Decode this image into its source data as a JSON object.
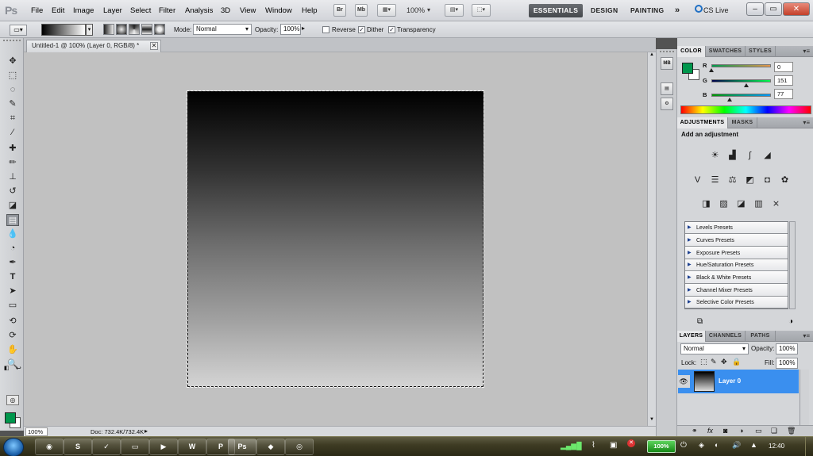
{
  "app": {
    "logo": "Ps"
  },
  "menu": [
    "File",
    "Edit",
    "Image",
    "Layer",
    "Select",
    "Filter",
    "Analysis",
    "3D",
    "View",
    "Window",
    "Help"
  ],
  "appbar": {
    "bridge": "Br",
    "minibridge": "Mb",
    "zoom": "100%",
    "more": "»"
  },
  "workspaces": [
    "ESSENTIALS",
    "DESIGN",
    "PAINTING"
  ],
  "cs_live": "CS Live",
  "window_controls": {
    "minimize": "–",
    "restore": "▭",
    "close": "✕"
  },
  "options": {
    "mode_label": "Mode:",
    "mode_value": "Normal",
    "opacity_label": "Opacity:",
    "opacity_value": "100%",
    "reverse_label": "Reverse",
    "dither_label": "Dither",
    "transparency_label": "Transparency",
    "reverse_checked": false,
    "dither_checked": true,
    "transparency_checked": true
  },
  "document_tab": {
    "title": "Untitled-1 @ 100% (Layer 0, RGB/8) *",
    "close": "✕"
  },
  "status": {
    "zoom": "100%",
    "doc": "Doc: 732.4K/732.4K"
  },
  "colors": {
    "foreground": "#00974d",
    "background": "#ffffff",
    "selected_layer": "#3a8fef"
  },
  "color_panel": {
    "tabs": [
      "COLOR",
      "SWATCHES",
      "STYLES"
    ],
    "channels": [
      {
        "label": "R",
        "value": "0",
        "level": 0.0
      },
      {
        "label": "G",
        "value": "151",
        "level": 0.59
      },
      {
        "label": "B",
        "value": "77",
        "level": 0.3
      }
    ]
  },
  "adjustments_panel": {
    "tabs": [
      "ADJUSTMENTS",
      "MASKS"
    ],
    "heading": "Add an adjustment",
    "presets": [
      "Levels Presets",
      "Curves Presets",
      "Exposure Presets",
      "Hue/Saturation Presets",
      "Black & White Presets",
      "Channel Mixer Presets",
      "Selective Color Presets"
    ]
  },
  "layers_panel": {
    "tabs": [
      "LAYERS",
      "CHANNELS",
      "PATHS"
    ],
    "blend_mode": "Normal",
    "opacity_label": "Opacity:",
    "opacity_value": "100%",
    "lock_label": "Lock:",
    "fill_label": "Fill:",
    "fill_value": "100%",
    "layer_name": "Layer 0"
  },
  "taskbar": {
    "battery": "100%",
    "clock": "12:40"
  }
}
